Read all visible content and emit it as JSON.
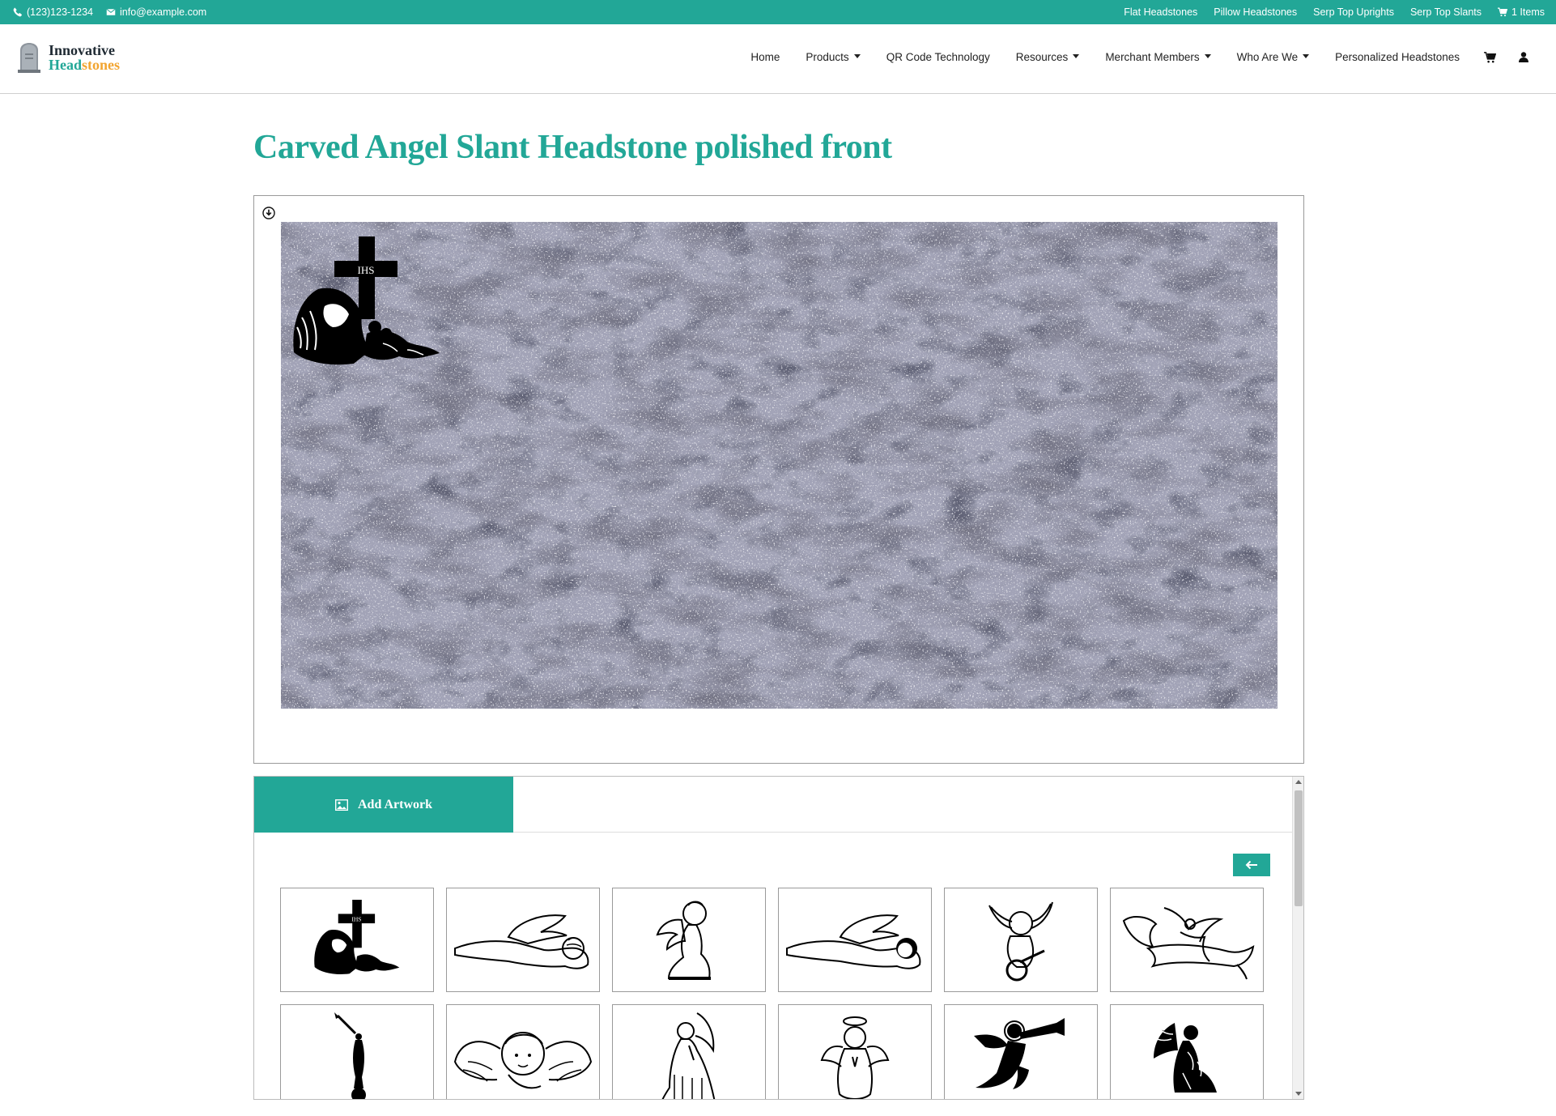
{
  "colors": {
    "brand_teal": "#22a797",
    "brand_orange": "#f2a531",
    "text_dark": "#222222"
  },
  "topbar": {
    "phone": "(123)123-1234",
    "email": "info@example.com",
    "links": [
      "Flat Headstones",
      "Pillow Headstones",
      "Serp Top Uprights",
      "Serp Top Slants"
    ],
    "cart_label": "1 Items"
  },
  "logo": {
    "line1": "Innovative",
    "line2a": "Head",
    "line2b": "stones"
  },
  "nav": {
    "items": [
      {
        "label": "Home",
        "dropdown": false
      },
      {
        "label": "Products",
        "dropdown": true
      },
      {
        "label": "QR Code Technology",
        "dropdown": false
      },
      {
        "label": "Resources",
        "dropdown": true
      },
      {
        "label": "Merchant Members",
        "dropdown": true
      },
      {
        "label": "Who Are We",
        "dropdown": true
      },
      {
        "label": "Personalized Headstones",
        "dropdown": false
      }
    ],
    "icons": [
      "cart-icon",
      "user-icon"
    ]
  },
  "page": {
    "title": "Carved Angel Slant Headstone polished front"
  },
  "designer": {
    "download_icon": "download-circle-icon",
    "canvas_artwork": "angel-with-cross-ihs"
  },
  "panel": {
    "tab_label": "Add Artwork",
    "tab_icon": "image-icon",
    "back_icon": "arrow-left-icon",
    "artworks": [
      "angel-with-cross-ihs",
      "sleeping-cherub-1",
      "kneeling-cherub",
      "sleeping-cherub-2",
      "cherub-with-banjo",
      "flying-angel-with-banner",
      "angel-moroni-statue",
      "cherub-face-with-wings",
      "praying-angel",
      "haloed-praying-angel",
      "trumpet-angel-silhouette",
      "kneeling-angel-silhouette"
    ]
  }
}
